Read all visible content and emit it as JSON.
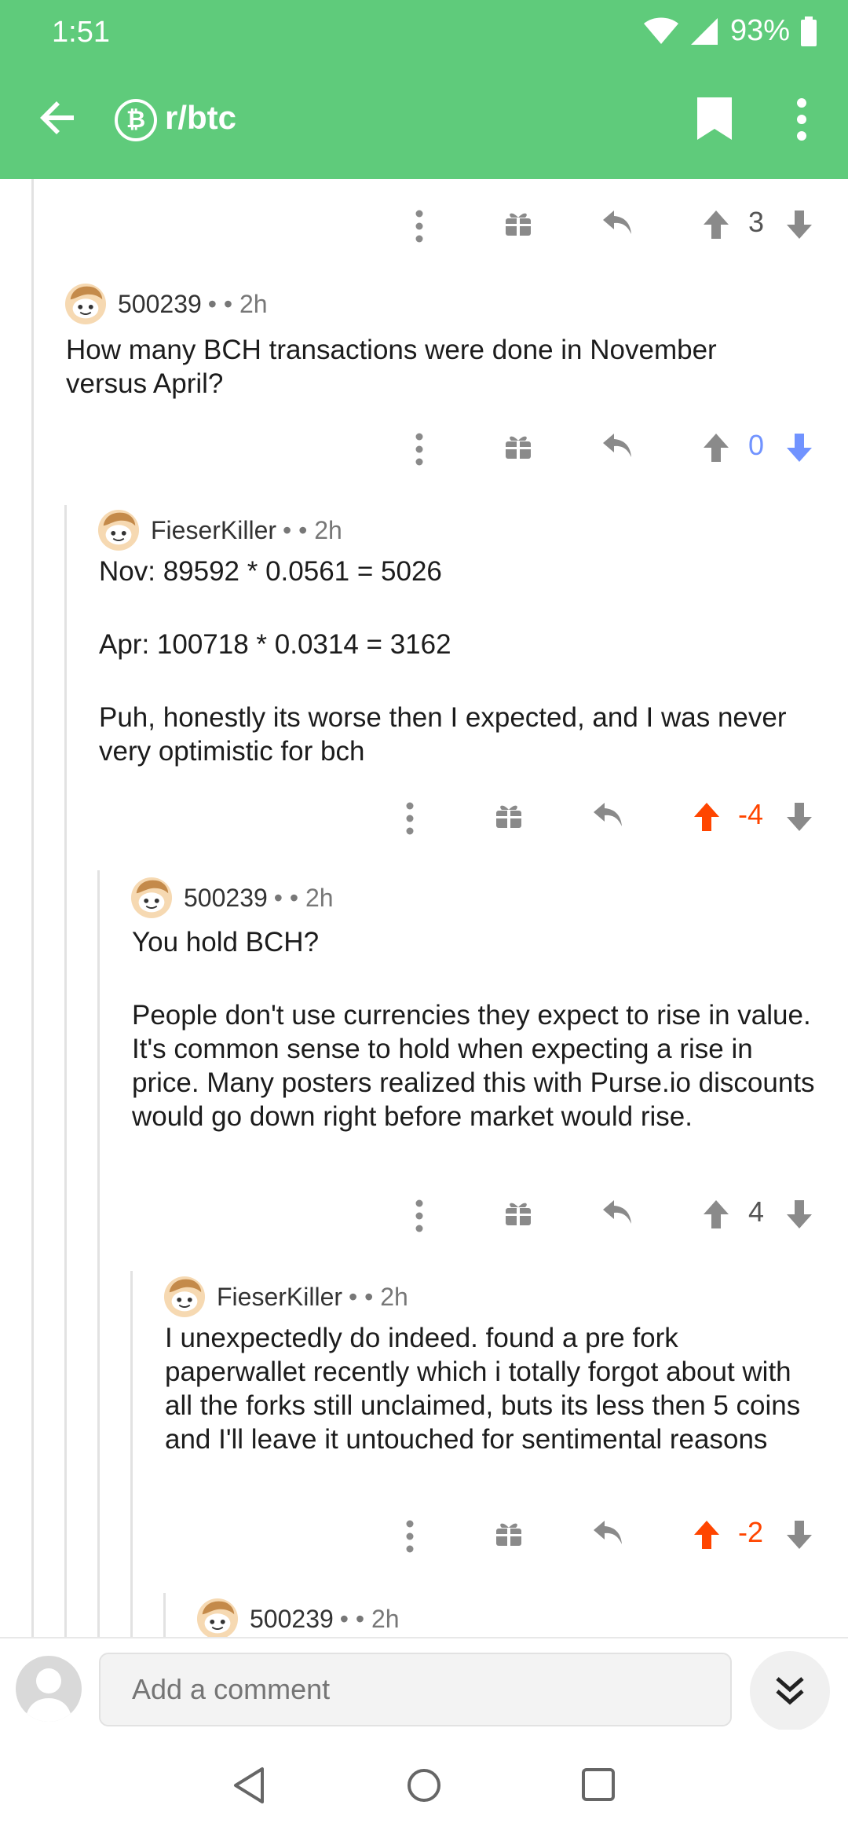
{
  "status": {
    "time": "1:51",
    "battery": "93%"
  },
  "appbar": {
    "subreddit": "r/btc",
    "sub_icon_letter": "₿"
  },
  "comments": [
    {
      "top_score": "3"
    },
    {
      "author": "500239",
      "meta": "• • 2h",
      "lines": [
        "How many BCH transactions were done in November versus April?"
      ],
      "score": "0"
    },
    {
      "author": "FieserKiller",
      "meta": "• • 2h",
      "lines": [
        "Nov: 89592 * 0.0561 = 5026",
        "Apr: 100718 * 0.0314 = 3162",
        "Puh, honestly its worse then I expected, and I was never very optimistic for bch"
      ],
      "score": "-4"
    },
    {
      "author": "500239",
      "meta": "• • 2h",
      "lines": [
        "You hold BCH?",
        "People don't use currencies they expect to rise in value. It's common sense to hold when expecting a rise in price. Many posters realized this with Purse.io discounts would go down right before market would rise."
      ],
      "score": "4"
    },
    {
      "author": "FieserKiller",
      "meta": "• • 2h",
      "lines": [
        "I unexpectedly do indeed. found a pre fork paperwallet recently which i totally forgot about with all the forks still unclaimed, buts its less then 5 coins and I'll leave it untouched for sentimental reasons"
      ],
      "score": "-2"
    },
    {
      "author": "500239",
      "meta": "• • 2h"
    }
  ],
  "composer": {
    "placeholder": "Add a comment"
  },
  "colors": {
    "brand": "#5fcb7b",
    "upvote": "#ff4500",
    "downvote": "#7193ff",
    "icon": "#8a8a8a"
  }
}
